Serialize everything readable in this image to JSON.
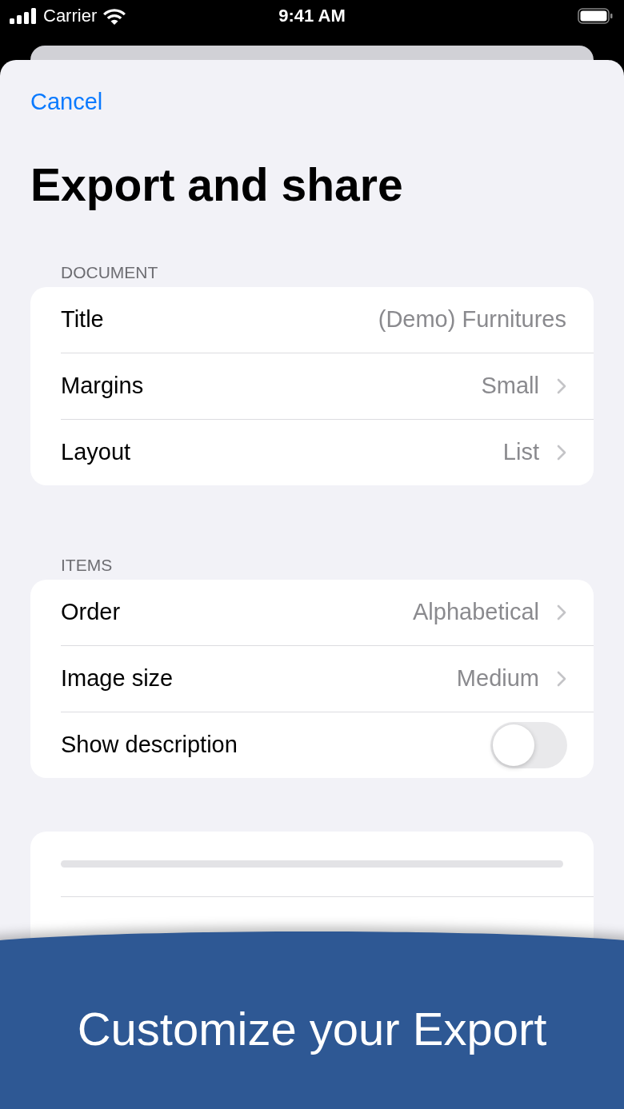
{
  "status_bar": {
    "carrier": "Carrier",
    "time": "9:41 AM"
  },
  "cancel": "Cancel",
  "title": "Export and share",
  "sections": [
    {
      "header": "DOCUMENT",
      "rows": [
        {
          "kind": "value",
          "label": "Title",
          "value": "(Demo) Furnitures"
        },
        {
          "kind": "link",
          "label": "Margins",
          "value": "Small"
        },
        {
          "kind": "link",
          "label": "Layout",
          "value": "List"
        }
      ]
    },
    {
      "header": "ITEMS",
      "rows": [
        {
          "kind": "link",
          "label": "Order",
          "value": "Alphabetical"
        },
        {
          "kind": "link",
          "label": "Image size",
          "value": "Medium"
        },
        {
          "kind": "toggle",
          "label": "Show description",
          "on": false
        }
      ]
    }
  ],
  "banner": {
    "text": "Customize your Export"
  }
}
